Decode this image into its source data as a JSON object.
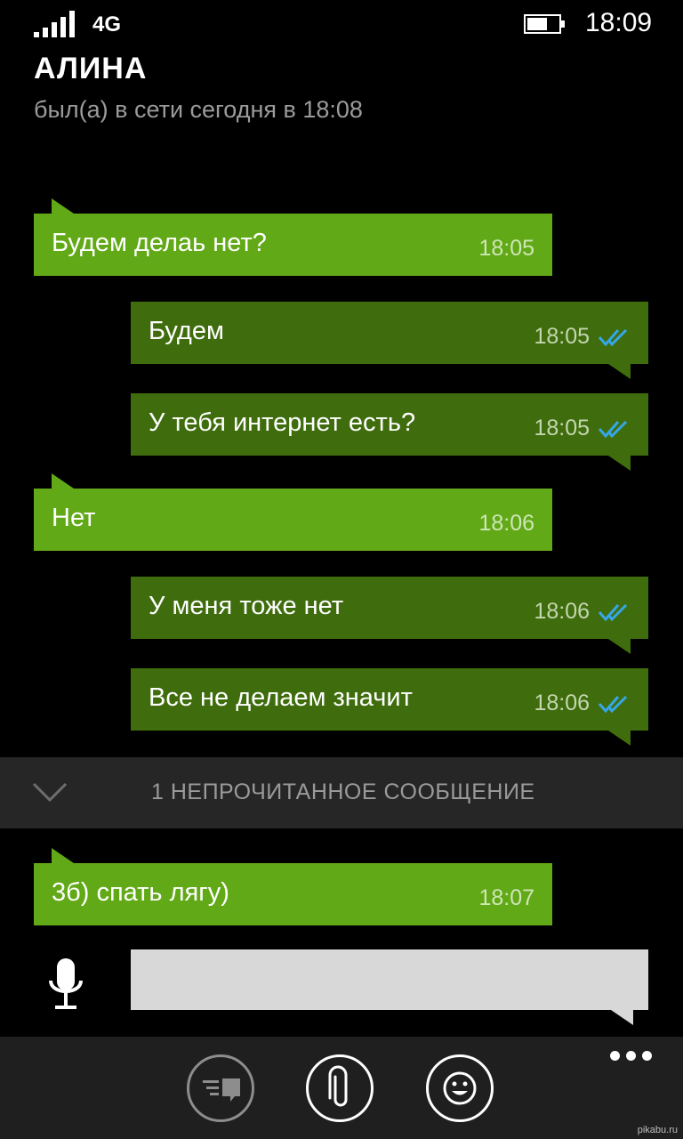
{
  "status_bar": {
    "network": "4G",
    "time": "18:09"
  },
  "header": {
    "contact_name": "АЛИНА",
    "last_seen": "был(а) в сети сегодня в 18:08"
  },
  "messages": [
    {
      "direction": "incoming",
      "text": "Будем делаь нет?",
      "time": "18:05"
    },
    {
      "direction": "outgoing",
      "text": "Будем",
      "time": "18:05",
      "status": "read"
    },
    {
      "direction": "outgoing",
      "text": "У тебя интернет есть?",
      "time": "18:05",
      "status": "read"
    },
    {
      "direction": "incoming",
      "text": "Нет",
      "time": "18:06"
    },
    {
      "direction": "outgoing",
      "text": "У меня тоже нет",
      "time": "18:06",
      "status": "read"
    },
    {
      "direction": "outgoing",
      "text": "Все не делаем значит",
      "time": "18:06",
      "status": "read"
    },
    {
      "direction": "incoming",
      "text": "3б) спать лягу)",
      "time": "18:07"
    }
  ],
  "unread_divider": {
    "label": "1 НЕПРОЧИТАННОЕ СООБЩЕНИЕ",
    "icon": "chevron-down-icon"
  },
  "compose": {
    "value": "",
    "mic_icon": "microphone-icon"
  },
  "app_bar": {
    "buttons": [
      {
        "icon": "quick-reply-icon",
        "enabled": false
      },
      {
        "icon": "paperclip-icon",
        "enabled": true
      },
      {
        "icon": "smiley-icon",
        "enabled": true
      }
    ],
    "more_icon": "more-dots-icon"
  },
  "watermark": "pikabu.ru",
  "colors": {
    "incoming_bubble": "#61a917",
    "outgoing_bubble": "#3f6d0d",
    "read_ticks": "#35a7e8",
    "divider_bg": "#262626",
    "app_bar_bg": "#1f1f1f"
  }
}
